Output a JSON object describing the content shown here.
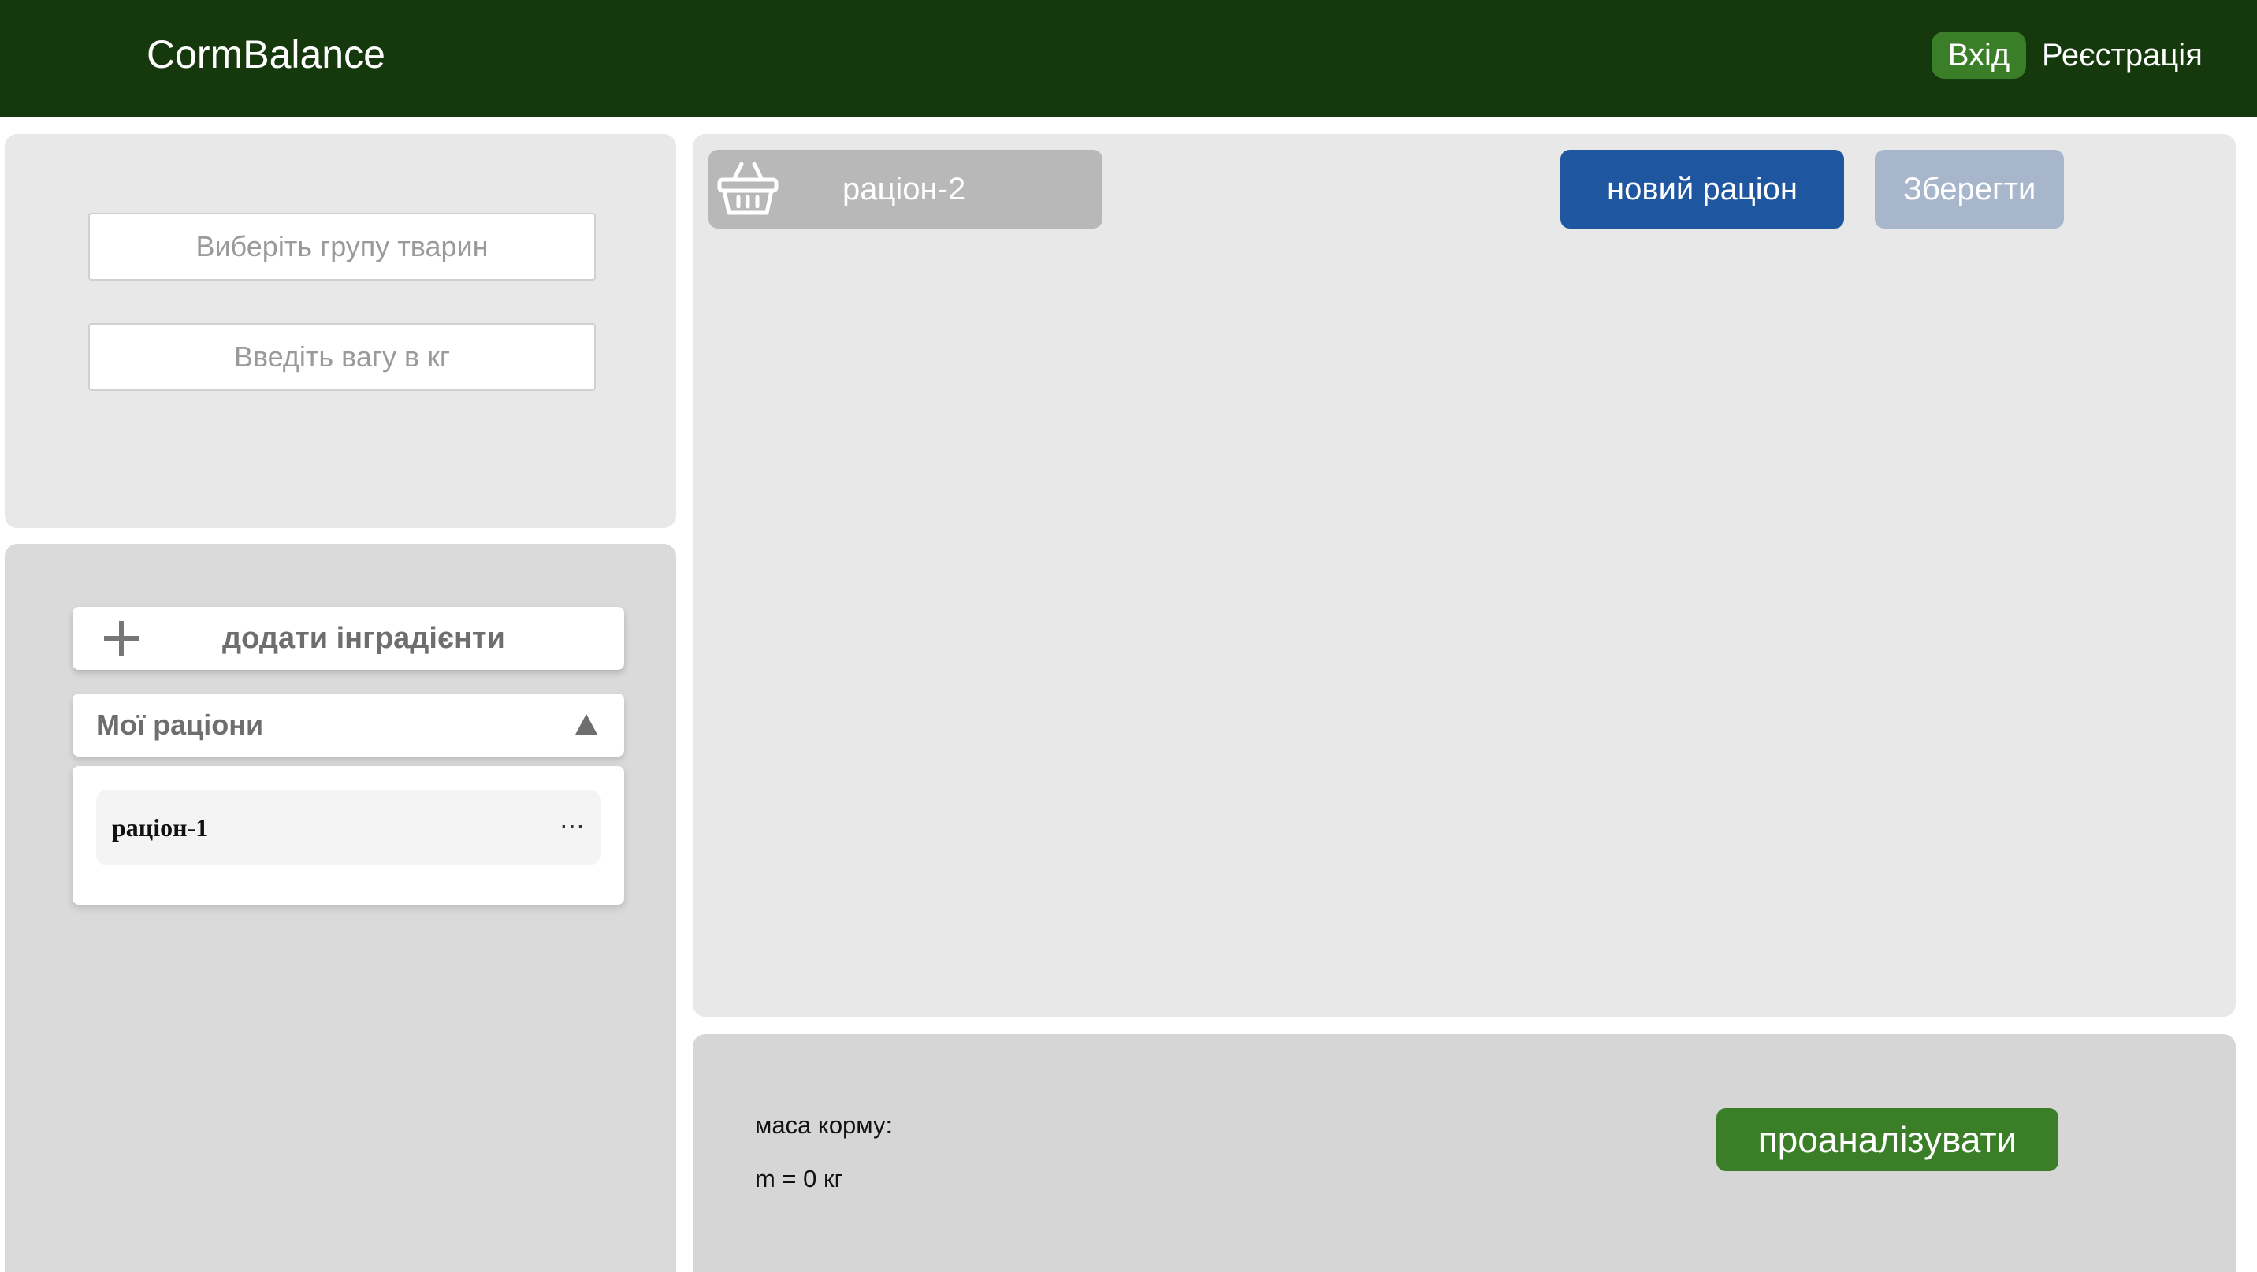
{
  "header": {
    "brand": "CormBalance",
    "login_label": "Вхід",
    "register_label": "Реєстрація"
  },
  "filters": {
    "animal_group_placeholder": "Виберіть групу тварин",
    "weight_placeholder": "Введіть вагу в кг"
  },
  "sidebar": {
    "add_ingredients_label": "додати інградієнти",
    "my_diets_label": "Мої раціони",
    "diets": [
      {
        "label": "раціон-1"
      }
    ]
  },
  "main": {
    "active_diet_label": "раціон-2",
    "new_diet_label": "новий раціон",
    "save_label": "Зберегти"
  },
  "summary": {
    "mass_label": "маса корму:",
    "mass_value": "m = 0 кг",
    "analyze_label": "проаналізувати"
  },
  "icons": {
    "add": "plus-icon",
    "toggle": "triangle-up-icon",
    "more": "more-horizontal-icon",
    "basket": "basket-icon"
  },
  "colors": {
    "header_bg": "#15380c",
    "accent_green": "#3a7f27",
    "primary_blue": "#1f56a0",
    "disabled_blue": "#a7b6cb"
  }
}
